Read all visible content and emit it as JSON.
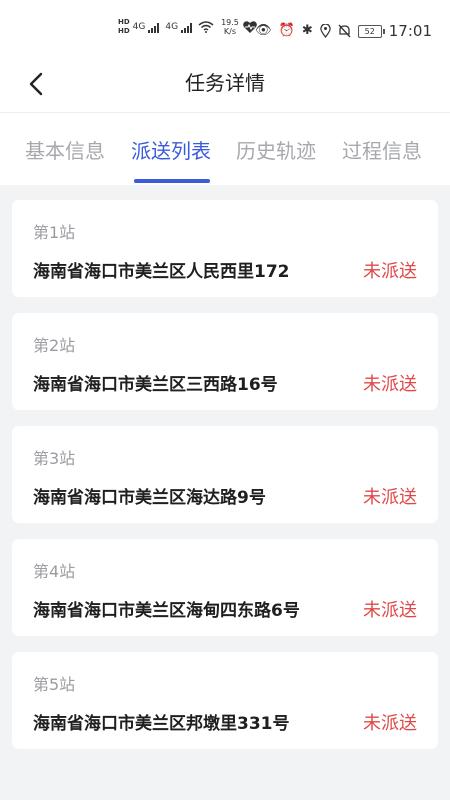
{
  "status_bar": {
    "hd_top": "HD",
    "hd_bottom": "HD",
    "net1": "4G",
    "net2": "4G",
    "speed_value": "19.5",
    "speed_unit": "K/s",
    "battery": "52",
    "time": "17:01"
  },
  "header": {
    "title": "任务详情"
  },
  "tabs": [
    {
      "label": "基本信息"
    },
    {
      "label": "派送列表"
    },
    {
      "label": "历史轨迹"
    },
    {
      "label": "过程信息"
    }
  ],
  "active_tab_index": 1,
  "stations": [
    {
      "station": "第1站",
      "address": "海南省海口市美兰区人民西里172",
      "status": "未派送"
    },
    {
      "station": "第2站",
      "address": "海南省海口市美兰区三西路16号",
      "status": "未派送"
    },
    {
      "station": "第3站",
      "address": "海南省海口市美兰区海达路9号",
      "status": "未派送"
    },
    {
      "station": "第4站",
      "address": "海南省海口市美兰区海甸四东路6号",
      "status": "未派送"
    },
    {
      "station": "第5站",
      "address": "海南省海口市美兰区邦墩里331号",
      "status": "未派送"
    }
  ],
  "colors": {
    "accent": "#3b5bdb",
    "status_pending": "#e04848"
  }
}
